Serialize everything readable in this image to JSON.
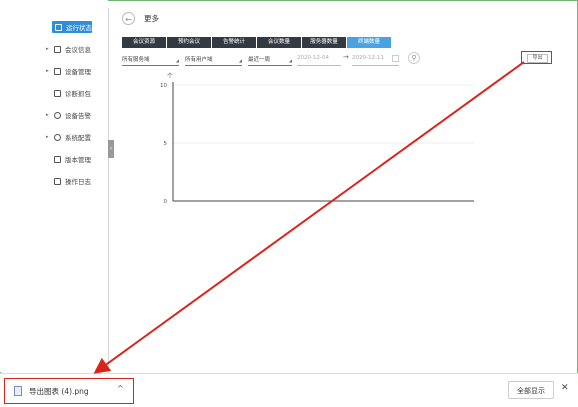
{
  "sidebar": {
    "items": [
      {
        "label": "运行状态",
        "icon": "monitor-icon",
        "caret": ""
      },
      {
        "label": "会议信息",
        "icon": "document-icon",
        "caret": "▸"
      },
      {
        "label": "设备管理",
        "icon": "server-icon",
        "caret": "▸"
      },
      {
        "label": "诊断抓包",
        "icon": "capture-icon",
        "caret": ""
      },
      {
        "label": "设备告警",
        "icon": "alert-icon",
        "caret": "▸"
      },
      {
        "label": "系统配置",
        "icon": "gear-icon",
        "caret": "▸"
      },
      {
        "label": "版本管理",
        "icon": "version-icon",
        "caret": ""
      },
      {
        "label": "操作日志",
        "icon": "log-icon",
        "caret": ""
      }
    ],
    "collapse_glyph": "‹"
  },
  "header": {
    "back_glyph": "←",
    "title": "更多"
  },
  "tabs": [
    "会议资源",
    "预约会议",
    "告警统计",
    "会议数量",
    "服务器数量",
    "终端数量"
  ],
  "filters": {
    "domain": "所有服务域",
    "user_domain": "所有用户域",
    "period": "最近一周",
    "date_from": "2020-12-04",
    "date_to": "2020-12-11",
    "date_arrow": "→",
    "search_glyph": "⚲"
  },
  "export_label": "导出",
  "chart_data": {
    "type": "line",
    "y_unit_glyph": "个",
    "yticks": [
      0,
      5,
      10
    ],
    "ylim": [
      0,
      10
    ],
    "series": [],
    "grid": true
  },
  "download_bar": {
    "file_name": "导出图表 (4).png",
    "chevron": "^",
    "show_all_label": "全部显示",
    "close_glyph": "✕"
  }
}
